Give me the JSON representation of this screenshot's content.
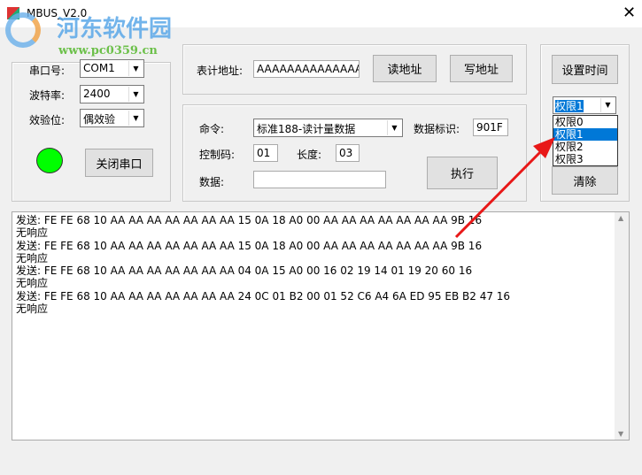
{
  "window": {
    "title": "MBUS_V2.0",
    "close": "✕"
  },
  "watermark": {
    "name": "河东软件园",
    "url": "www.pc0359.cn"
  },
  "serial": {
    "port_label": "串口号:",
    "port": "COM1",
    "baud_label": "波特率:",
    "baud": "2400",
    "parity_label": "效验位:",
    "parity": "偶效验",
    "close_button": "关闭串口",
    "led_color": "#00ff00"
  },
  "address": {
    "label": "表计地址:",
    "value": "AAAAAAAAAAAAAA",
    "read_button": "读地址",
    "write_button": "写地址"
  },
  "command": {
    "cmd_label": "命令:",
    "cmd": "标准188-读计量数据",
    "id_label": "数据标识:",
    "id": "901F",
    "ctrl_label": "控制码:",
    "ctrl": "01",
    "len_label": "长度:",
    "len": "03",
    "data_label": "数据:",
    "data": "",
    "exec_button": "执行"
  },
  "right": {
    "set_time_button": "设置时间",
    "permission": "权限1",
    "options": [
      "权限0",
      "权限1",
      "权限2",
      "权限3"
    ],
    "clear_button": "清除"
  },
  "log": {
    "lines": [
      "发送: FE FE 68 10 AA AA AA AA AA AA AA 15 0A 18 A0 00 AA AA AA AA AA AA AA 9B 16",
      "无响应",
      "发送: FE FE 68 10 AA AA AA AA AA AA AA 15 0A 18 A0 00 AA AA AA AA AA AA AA 9B 16",
      "无响应",
      "发送: FE FE 68 10 AA AA AA AA AA AA AA 04 0A 15 A0 00 16 02 19 14 01 19 20 60 16",
      "无响应",
      "发送: FE FE 68 10 AA AA AA AA AA AA AA 24 0C 01 B2 00 01 52 C6 A4 6A ED 95 EB B2 47 16",
      "无响应"
    ]
  }
}
